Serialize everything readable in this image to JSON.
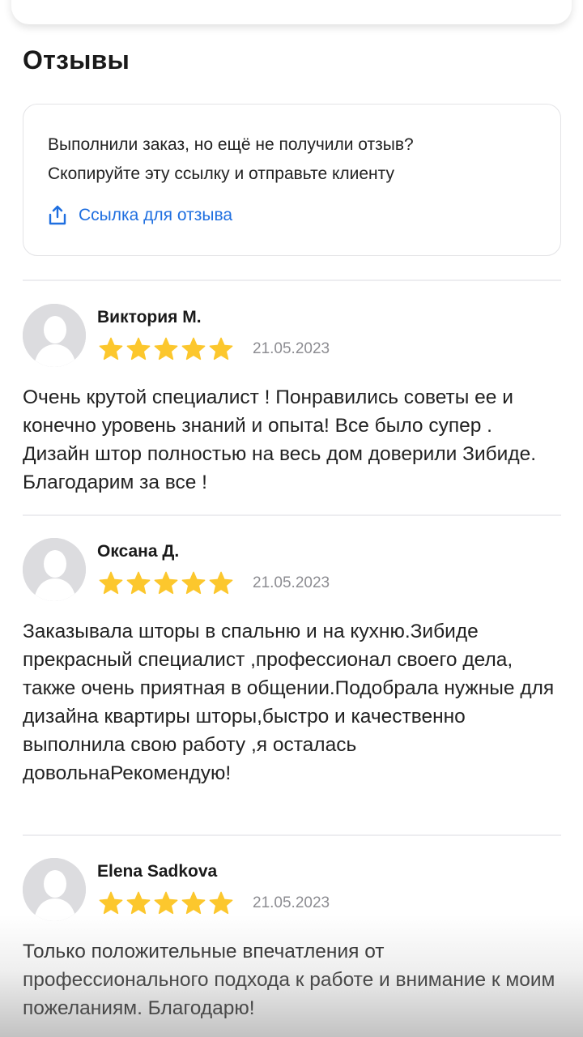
{
  "section": {
    "title": "Отзывы"
  },
  "info": {
    "line1": "Выполнили заказ, но ещё не получили отзыв?",
    "line2": "Скопируйте эту ссылку и отправьте клиенту",
    "link_label": "Ссылка для отзыва",
    "link_icon": "share-icon"
  },
  "colors": {
    "accent_link": "#1f6fe0",
    "star": "#fcc72d",
    "avatar_bg": "#dcdcdf",
    "date_text": "#8d8d92"
  },
  "reviews": [
    {
      "author": "Виктория М.",
      "rating": 5,
      "date": "21.05.2023",
      "text": "Очень крутой специалист ! Понравились советы ее и конечно уровень знаний и опыта! Все было супер . Дизайн штор полностью на весь дом доверили Зибиде. Благодарим за все !"
    },
    {
      "author": "Оксана Д.",
      "rating": 5,
      "date": "21.05.2023",
      "text": "Заказывала шторы в спальню и на кухню.Зибиде прекрасный специалист ,профессионал своего дела, также очень приятная в общении.Подобрала нужные для дизайна квартиры шторы,быстро и качественно выполнила свою работу ,я осталась довольнаРекомендую!"
    },
    {
      "author": "Elena Sadkova",
      "rating": 5,
      "date": "21.05.2023",
      "text": "Только положительные впечатления от профессионального подхода к работе и внимание к моим пожеланиям. Благодарю!"
    }
  ]
}
